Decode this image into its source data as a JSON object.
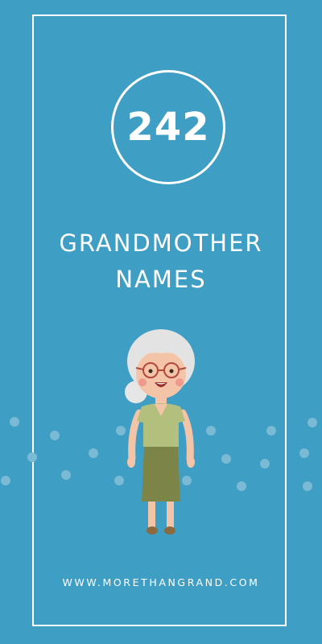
{
  "poster": {
    "count": "242",
    "title_line1": "GRANDMOTHER",
    "title_line2": "NAMES",
    "website": "WWW.MORETHANGRAND.COM"
  },
  "colors": {
    "background": "#3e9ec4",
    "text": "#ffffff",
    "dots": "#7bbad5"
  }
}
